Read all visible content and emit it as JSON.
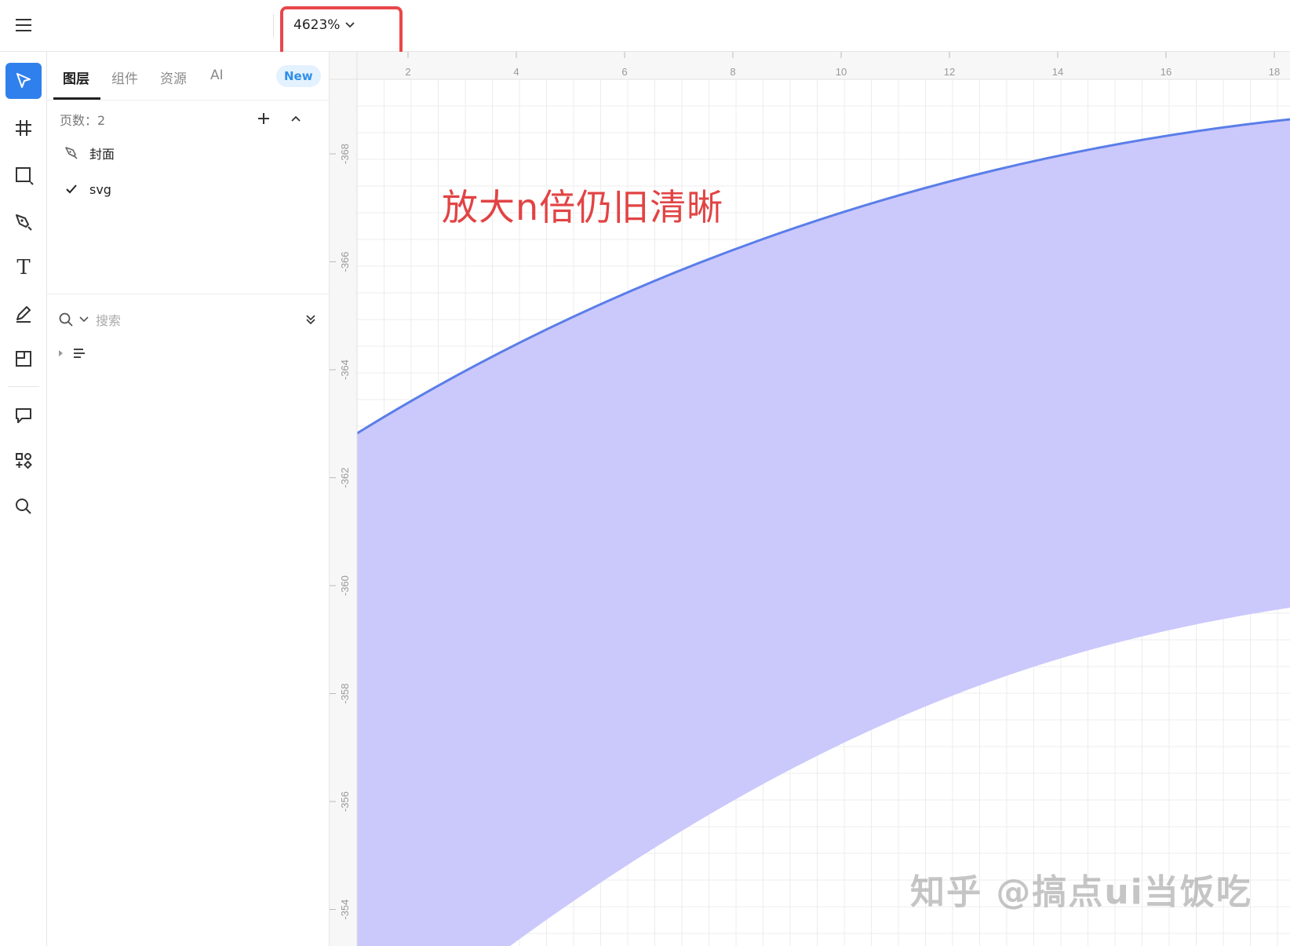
{
  "topbar": {
    "menu_icon": "hamburger-menu-icon",
    "zoom_value": "4623%",
    "zoom_dropdown_icon": "chevron-down-icon"
  },
  "toolbar": {
    "tools": [
      {
        "name": "move-tool",
        "icon": "pointer-icon",
        "active": true
      },
      {
        "name": "frame-tool",
        "icon": "hash-frame-icon"
      },
      {
        "name": "rectangle-tool",
        "icon": "rectangle-icon"
      },
      {
        "name": "pen-tool",
        "icon": "pen-nib-icon"
      },
      {
        "name": "text-tool",
        "icon": "text-T-icon"
      },
      {
        "name": "pencil-tool",
        "icon": "pencil-icon"
      },
      {
        "name": "slice-tool",
        "icon": "slice-icon"
      },
      {
        "name": "comment-tool",
        "icon": "comment-icon"
      },
      {
        "name": "plugins-tool",
        "icon": "components-icon"
      },
      {
        "name": "search-tool",
        "icon": "search-icon"
      }
    ],
    "text_tool_glyph": "T"
  },
  "panel": {
    "tabs": [
      {
        "label": "图层",
        "active": true
      },
      {
        "label": "组件"
      },
      {
        "label": "资源"
      },
      {
        "label": "AI"
      }
    ],
    "new_badge": "New",
    "pages_label": "页数：2",
    "pages": [
      {
        "label": "封面",
        "icon": "pen-nib-icon"
      },
      {
        "label": "svg",
        "icon": "check-icon",
        "selected": true
      }
    ],
    "search_placeholder": "搜索"
  },
  "canvas": {
    "ruler_x_labels": [
      "2",
      "4",
      "6",
      "8",
      "10",
      "12",
      "14",
      "16",
      "18"
    ],
    "ruler_y_labels": [
      "-368",
      "-366",
      "-364",
      "-362",
      "-360",
      "-358",
      "-356",
      "-354"
    ],
    "annotation": "放大n倍仍旧清晰",
    "watermark": "知乎 @搞点ui当饭吃",
    "fill_color": "#cbc8fc",
    "stroke_color": "#5a7ee8",
    "annotation_color": "#e24344",
    "highlight_color": "#e8474a"
  }
}
